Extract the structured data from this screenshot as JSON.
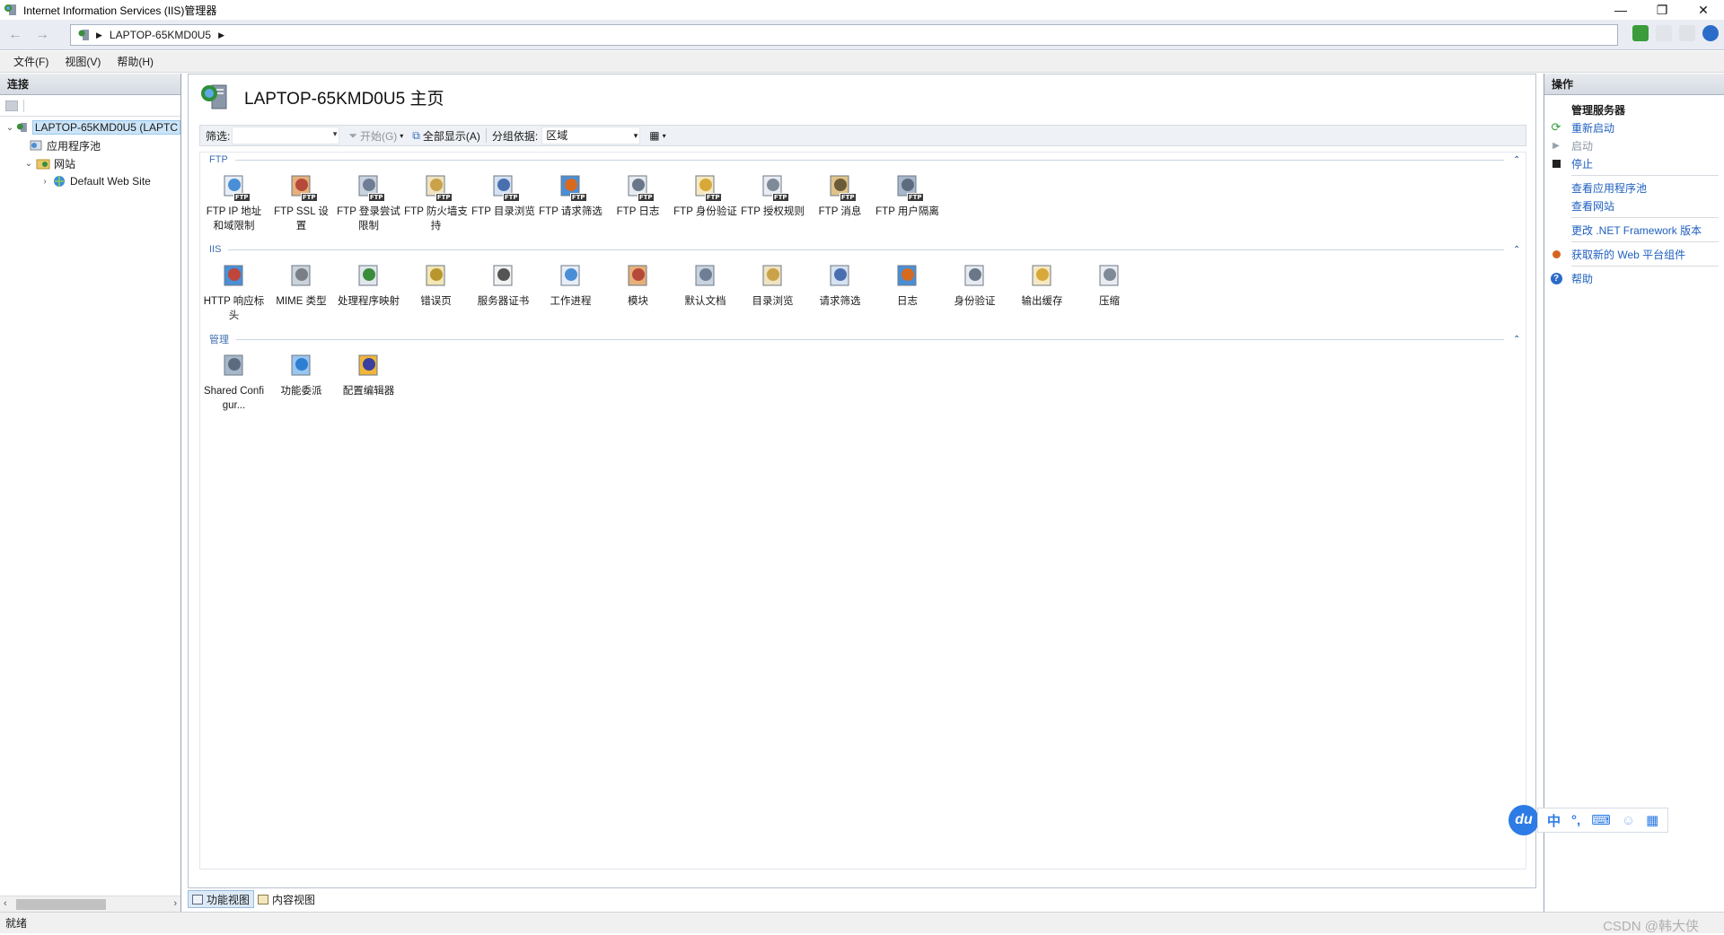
{
  "window": {
    "title": "Internet Information Services (IIS)管理器"
  },
  "address": {
    "segments": [
      "LAPTOP-65KMD0U5"
    ]
  },
  "menu": [
    "文件(F)",
    "视图(V)",
    "帮助(H)"
  ],
  "connections": {
    "header": "连接",
    "tree": [
      {
        "label": "LAPTOP-65KMD0U5 (LAPTC",
        "level": 0,
        "expanded": true,
        "selected": true
      },
      {
        "label": "应用程序池",
        "level": 1
      },
      {
        "label": "网站",
        "level": 1,
        "expanded": true
      },
      {
        "label": "Default Web Site",
        "level": 2,
        "collapsed": true
      }
    ]
  },
  "main": {
    "title": "LAPTOP-65KMD0U5 主页",
    "filter": {
      "label": "筛选:",
      "start": "开始(G)",
      "show_all": "全部显示(A)",
      "group_by_label": "分组依据:",
      "group_by_value": "区域"
    },
    "groups": [
      {
        "name": "FTP",
        "items": [
          "FTP IP 地址和域限制",
          "FTP SSL 设置",
          "FTP 登录尝试限制",
          "FTP 防火墙支持",
          "FTP 目录浏览",
          "FTP 请求筛选",
          "FTP 日志",
          "FTP 身份验证",
          "FTP 授权规则",
          "FTP 消息",
          "FTP 用户隔离"
        ]
      },
      {
        "name": "IIS",
        "items": [
          "HTTP 响应标头",
          "MIME 类型",
          "处理程序映射",
          "错误页",
          "服务器证书",
          "工作进程",
          "模块",
          "默认文档",
          "目录浏览",
          "请求筛选",
          "日志",
          "身份验证",
          "输出缓存",
          "压缩"
        ]
      },
      {
        "name": "管理",
        "items": [
          "Shared Configur...",
          "功能委派",
          "配置编辑器"
        ]
      }
    ],
    "tabs": [
      "功能视图",
      "内容视图"
    ]
  },
  "actions": {
    "header": "操作",
    "section_title": "管理服务器",
    "restart": "重新启动",
    "start": "启动",
    "stop": "停止",
    "view_app_pools": "查看应用程序池",
    "view_sites": "查看网站",
    "change_net": "更改 .NET Framework 版本",
    "get_web_platform": "获取新的 Web 平台组件",
    "help": "帮助"
  },
  "status": {
    "text": "就绪",
    "watermark": "CSDN @韩大侠"
  },
  "ime": {
    "logo": "du",
    "mode": "中",
    "punct": "°,"
  },
  "colors": {
    "link": "#1f5fbf",
    "accent": "#2d7be5",
    "group_header": "#3e6fae"
  }
}
